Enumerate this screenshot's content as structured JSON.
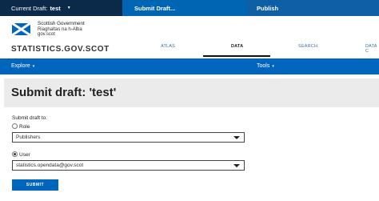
{
  "topbar": {
    "current_draft_label": "Current Draft:",
    "current_draft_value": "test",
    "submit_draft": "Submit Draft...",
    "publish": "Publish"
  },
  "gov": {
    "line1": "Scottish Government",
    "line2": "Riaghaltas na h-Alba",
    "line3": "gov.scot"
  },
  "brand": "STATISTICS.GOV.SCOT",
  "nav": {
    "atlas": "ATLAS",
    "data": "DATA",
    "search": "SEARCH",
    "data_cube": "DATA C"
  },
  "subbar": {
    "explore": "Explore",
    "tools": "Tools"
  },
  "page_title": "Submit draft: 'test'",
  "form": {
    "submit_to_label": "Submit draft to:",
    "role_label": "Role",
    "role_value": "Publishers",
    "user_label": "User",
    "user_value": "statistics.opendata@gov.scot",
    "submit_button": "SUBMIT"
  },
  "colors": {
    "primary_blue": "#0065bd",
    "draft_dark": "#0b2a4a"
  }
}
